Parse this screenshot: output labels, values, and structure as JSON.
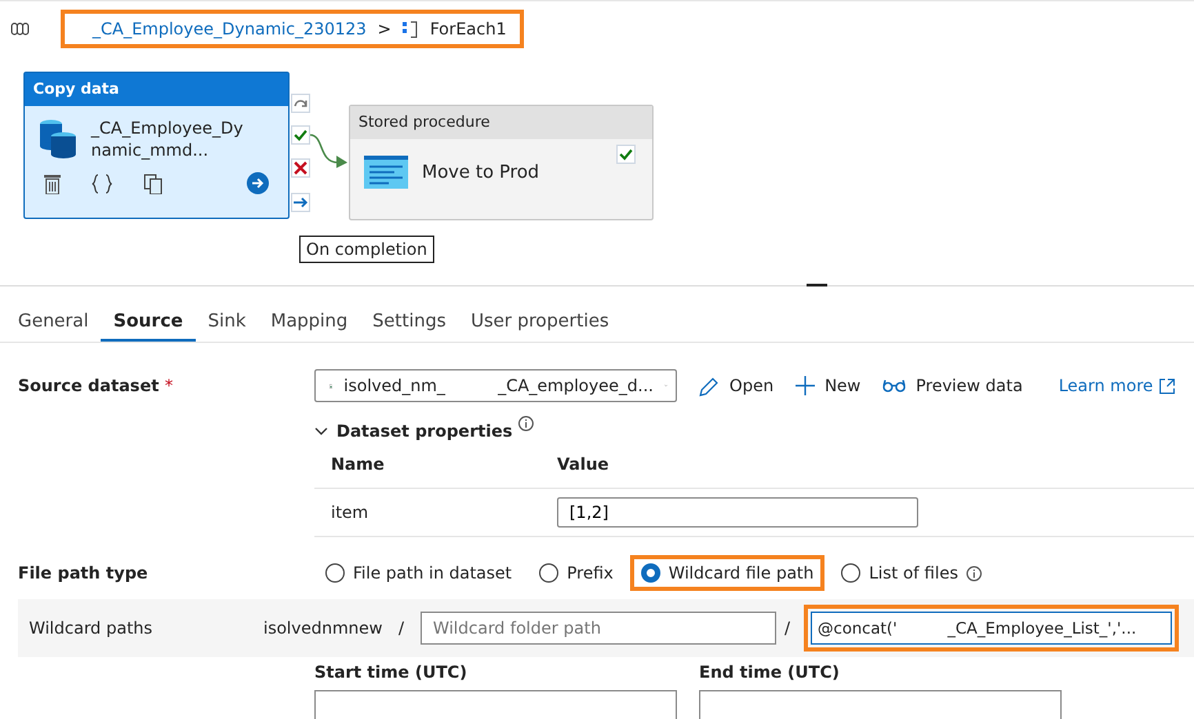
{
  "breadcrumb": {
    "highlighted": true,
    "pipeline": "_CA_Employee_Dynamic_230123",
    "separator": ">",
    "current": "ForEach1"
  },
  "canvas": {
    "nodes": [
      {
        "kind": "copy",
        "title": "Copy data",
        "name": "_CA_Employee_Dynamic_mmd...",
        "selected": true
      },
      {
        "kind": "procedure",
        "title": "Stored procedure",
        "name": "Move to Prod",
        "selected": false
      }
    ],
    "tooltip": "On completion"
  },
  "tabs": [
    {
      "label": "General",
      "selected": false
    },
    {
      "label": "Source",
      "selected": true
    },
    {
      "label": "Sink",
      "selected": false
    },
    {
      "label": "Mapping",
      "selected": false
    },
    {
      "label": "Settings",
      "selected": false
    },
    {
      "label": "User properties",
      "selected": false
    }
  ],
  "source_dataset": {
    "label": "Source dataset",
    "required_mark": "*",
    "value": "isolved_nm_          _CA_employee_d...",
    "actions": [
      {
        "kind": "edit",
        "label": "Open"
      },
      {
        "kind": "add",
        "label": "New"
      },
      {
        "kind": "preview",
        "label": "Preview data"
      }
    ],
    "learn_more": "Learn more"
  },
  "dataset_properties": {
    "label": "Dataset properties",
    "expanded": true,
    "columns": [
      "Name",
      "Value"
    ],
    "rows": [
      {
        "name": "item",
        "value": "[1,2]"
      }
    ]
  },
  "file_path_type": {
    "label": "File path type",
    "options": [
      {
        "label": "File path in dataset",
        "selected": false,
        "highlighted": false,
        "info": false
      },
      {
        "label": "Prefix",
        "selected": false,
        "highlighted": false,
        "info": false
      },
      {
        "label": "Wildcard file path",
        "selected": true,
        "highlighted": true,
        "info": false
      },
      {
        "label": "List of files",
        "selected": false,
        "highlighted": false,
        "info": true
      }
    ]
  },
  "wildcard_paths": {
    "label": "Wildcard paths",
    "container": "isolvednmnew",
    "separator_1": "/",
    "folder_placeholder": "Wildcard folder path",
    "separator_2": "/",
    "file_value": "@concat('          _CA_Employee_List_','...",
    "file_highlighted": true
  },
  "time_range": {
    "start_label": "Start time (UTC)",
    "end_label": "End time (UTC)"
  }
}
